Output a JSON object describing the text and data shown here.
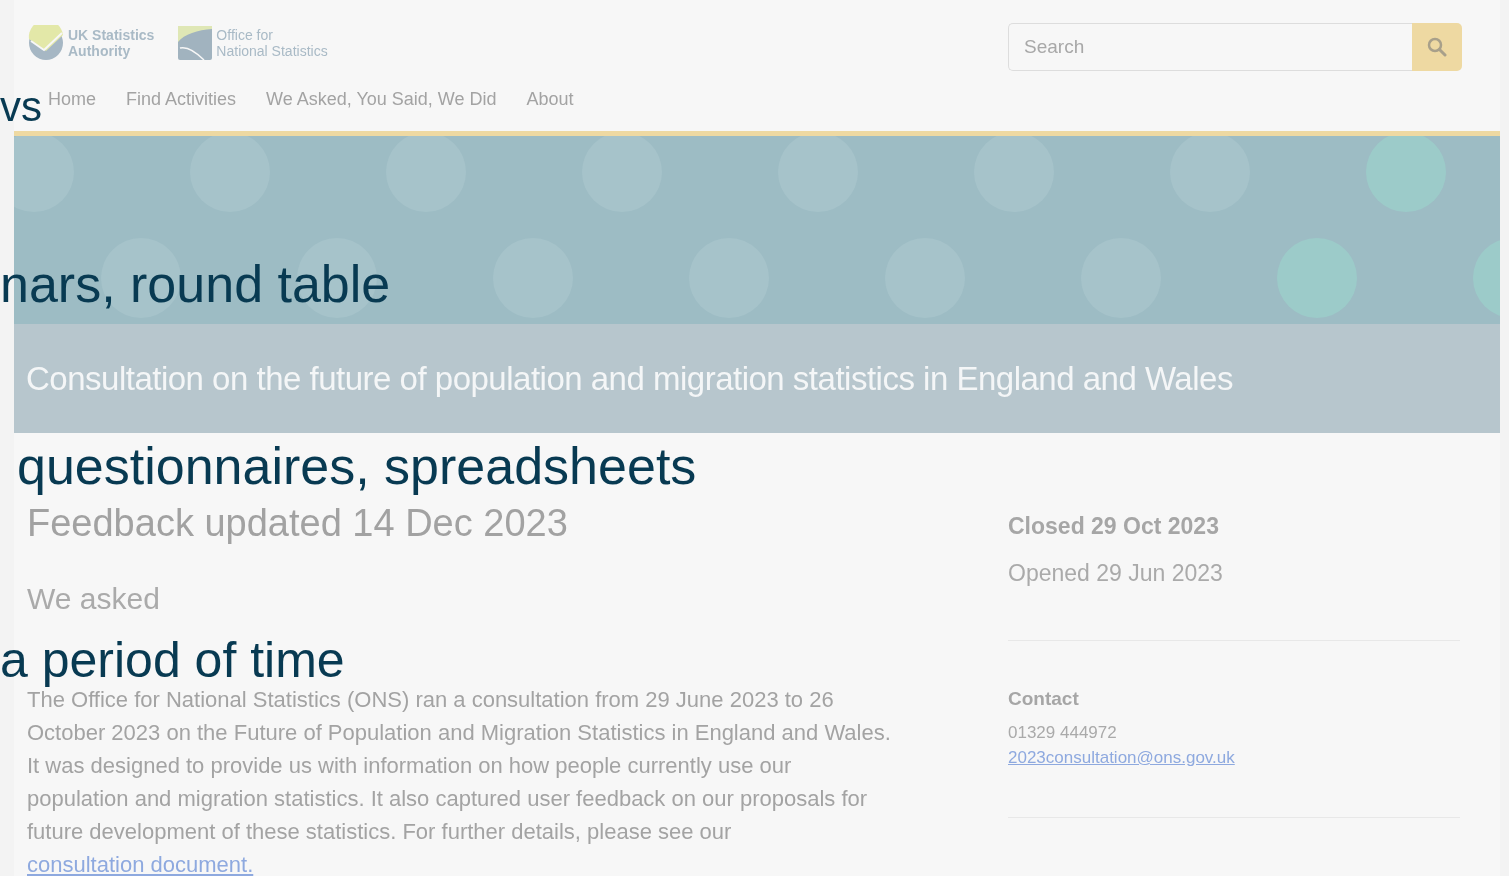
{
  "logos": [
    {
      "kind": "authority",
      "lines": [
        "UK Statistics",
        "Authority"
      ]
    },
    {
      "kind": "office",
      "lines": [
        "Office for",
        "National Statistics"
      ]
    }
  ],
  "search": {
    "placeholder": "Search"
  },
  "nav": [
    {
      "label": "Home"
    },
    {
      "label": "Find Activities"
    },
    {
      "label": "We Asked, You Said, We Did"
    },
    {
      "label": "About"
    }
  ],
  "banner": {
    "subtitle": "Consultation on the future of population and migration statistics in England and Wales"
  },
  "main": {
    "updated": "Feedback updated 14 Dec 2023",
    "heading": "We asked",
    "paragraph": "The Office for National Statistics (ONS) ran a consultation from 29 June 2023 to 26 October 2023 on the Future of Population and Migration Statistics in England and Wales. It was designed to provide us with information on how people currently use our population and migration statistics. It also captured user feedback on our proposals for future development of these statistics. For further details, please see our ",
    "link": "consultation document."
  },
  "sidebar": {
    "closed": "Closed 29 Oct 2023",
    "opened": "Opened 29 Jun 2023",
    "contact_heading": "Contact",
    "phone": "01329 444972",
    "email": "2023consultation@ons.gov.uk"
  },
  "overlays": [
    "vs",
    "nars, round table",
    "questionnaires, spreadsheets",
    "a period of time"
  ]
}
